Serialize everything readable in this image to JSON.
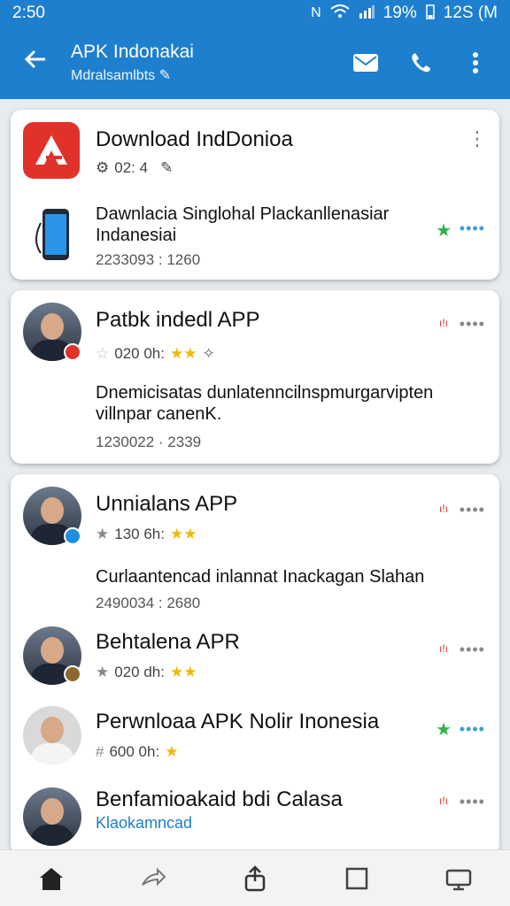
{
  "status": {
    "time": "2:50",
    "battery": "19%",
    "clock": "12S (M"
  },
  "appbar": {
    "title": "APK Indonakai",
    "subtitle": "Mdralsamlbts"
  },
  "card1": {
    "title": "Download IndDonioa",
    "meta": "02: 4",
    "item_text": "Dawnlacia Singlohal Plackanllenasiar Indanesiai",
    "item_time": "2233093 : 1260"
  },
  "card2": {
    "title": "Patbk indedl APP",
    "meta": "020 0h:",
    "desc": "Dnemicisatas dunlatenncilnspmurgarvipten villnpar canenK.",
    "time": "1230022 · 2339"
  },
  "card3": {
    "title": "Unnialans APP",
    "meta": "130 6h:",
    "desc": "Curlaantencad inlannat Inackagan Slahan",
    "time": "2490034 : 2680"
  },
  "item4": {
    "title": "Behtalena APR",
    "meta": "020 dh:"
  },
  "item5": {
    "title": "Perwnloaa APK Nolir  Inonesia",
    "meta": "600 0h:"
  },
  "item6": {
    "title": "Benfamioakaid bdi Calasa",
    "sub": "Klaokamncad"
  },
  "icons": {
    "back": "arrow-left-icon",
    "mail": "mail-icon",
    "phone": "phone-icon",
    "overflow": "more-vert-icon"
  },
  "colors": {
    "primary": "#1e7fcf",
    "star": "#f2b705",
    "green": "#2fb34a"
  }
}
